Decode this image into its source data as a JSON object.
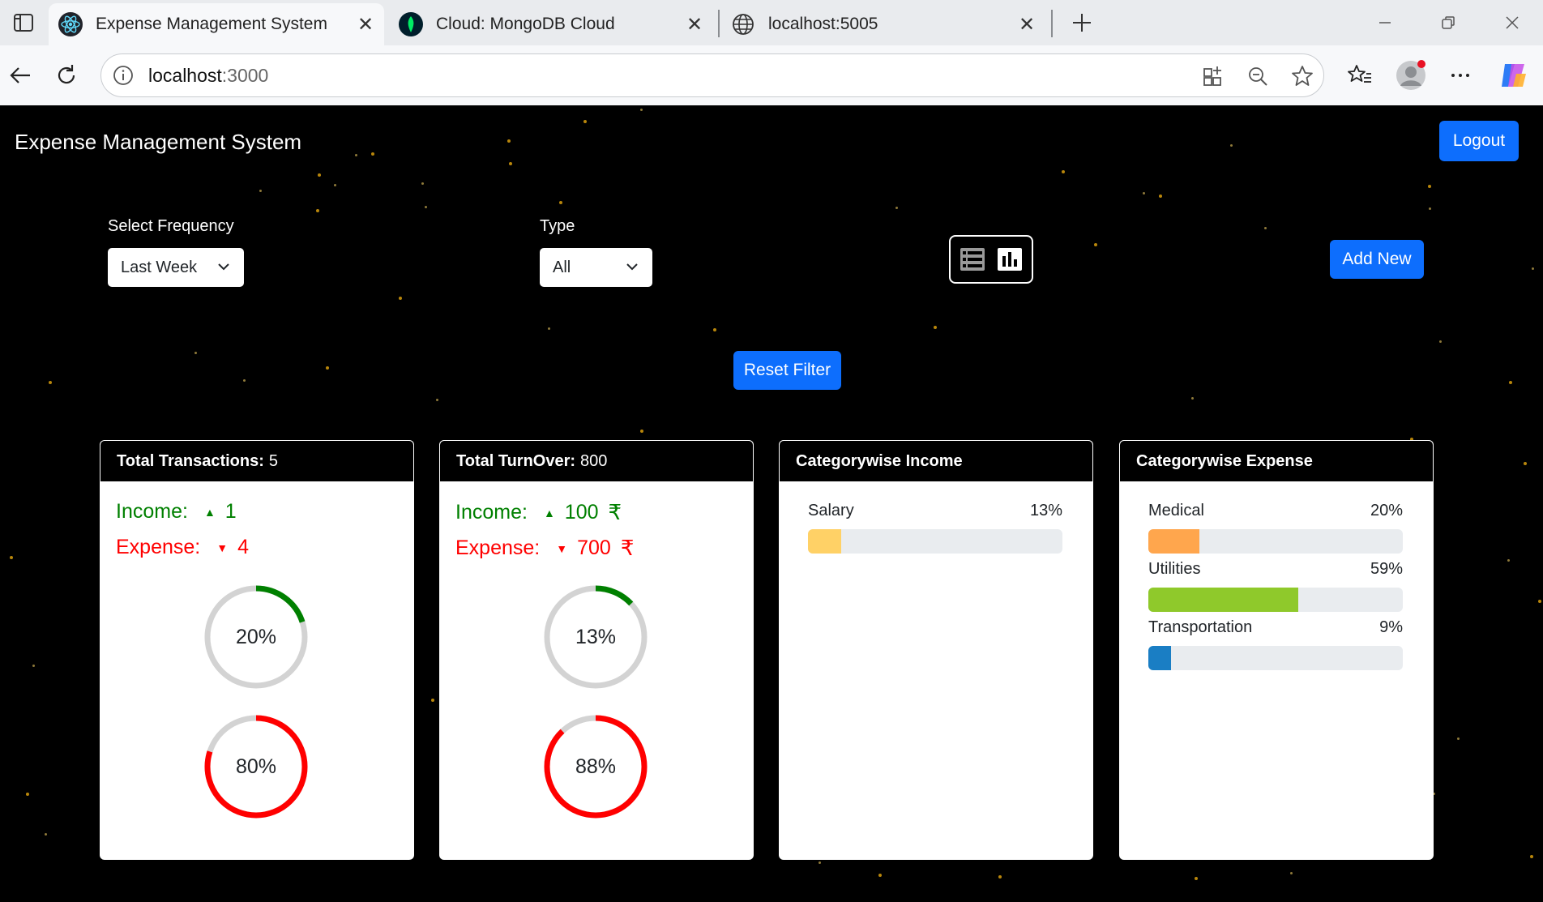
{
  "browser": {
    "tabs": [
      {
        "title": "Expense Management System",
        "icon": "react-icon",
        "active": true
      },
      {
        "title": "Cloud: MongoDB Cloud",
        "icon": "mongodb-leaf-icon",
        "active": false
      },
      {
        "title": "localhost:5005",
        "icon": "globe-icon",
        "active": false
      }
    ],
    "url_host": "localhost",
    "url_port": ":3000"
  },
  "app": {
    "title": "Expense Management System",
    "logout_label": "Logout",
    "filters": {
      "frequency_label": "Select Frequency",
      "frequency_value": "Last Week",
      "type_label": "Type",
      "type_value": "All"
    },
    "add_new_label": "Add New",
    "reset_filter_label": "Reset Filter",
    "colors": {
      "primary": "#0d6efd",
      "income": "#008000",
      "expense": "#ff0000"
    }
  },
  "cards": {
    "transactions": {
      "title": "Total Transactions:",
      "value": "5",
      "income_label": "Income:",
      "income_value": "1",
      "expense_label": "Expense:",
      "expense_value": "4",
      "income_percent_label": "20%",
      "income_percent": 20,
      "expense_percent_label": "80%",
      "expense_percent": 80
    },
    "turnover": {
      "title": "Total TurnOver:",
      "value": "800",
      "income_label": "Income:",
      "income_value": "100",
      "expense_label": "Expense:",
      "expense_value": "700",
      "currency": "₹",
      "income_percent_label": "13%",
      "income_percent": 13,
      "expense_percent_label": "88%",
      "expense_percent": 88
    },
    "category_income": {
      "title": "Categorywise Income",
      "items": [
        {
          "name": "Salary",
          "percent_label": "13%",
          "percent": 13,
          "color": "#ffd166"
        }
      ]
    },
    "category_expense": {
      "title": "Categorywise Expense",
      "items": [
        {
          "name": "Medical",
          "percent_label": "20%",
          "percent": 20,
          "color": "#ffa64d"
        },
        {
          "name": "Utilities",
          "percent_label": "59%",
          "percent": 59,
          "color": "#8fc92b"
        },
        {
          "name": "Transportation",
          "percent_label": "9%",
          "percent": 9,
          "color": "#1a7ec4"
        }
      ]
    }
  }
}
